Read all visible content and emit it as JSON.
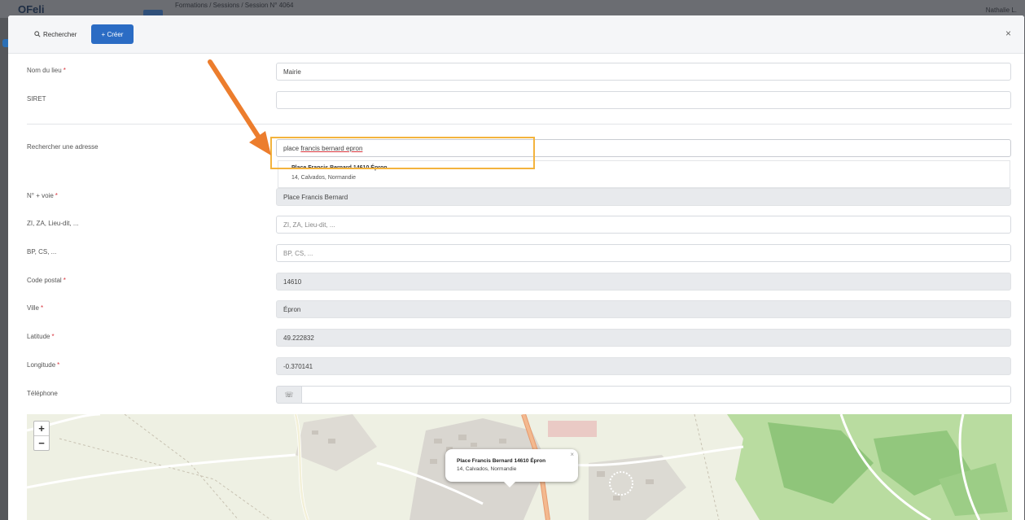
{
  "background": {
    "logo": "OFeli",
    "breadcrumb": "Formations / Sessions / Session N° 4064",
    "user": "Nathalie L."
  },
  "toolbar": {
    "search_label": "Rechercher",
    "create_label": "+ Créer",
    "close": "×"
  },
  "form": {
    "name": {
      "label": "Nom du lieu",
      "value": "Mairie"
    },
    "siret": {
      "label": "SIRET",
      "value": ""
    },
    "address_search": {
      "label": "Rechercher une adresse",
      "value_pre": "place ",
      "value_underlined": "francis bernard epron"
    },
    "suggestion": {
      "line1": "Place Francis Bernard 14610 Épron",
      "line2": "14, Calvados, Normandie"
    },
    "street": {
      "label": "N° + voie",
      "value": "Place Francis Bernard"
    },
    "zone": {
      "label": "ZI, ZA, Lieu-dit, ...",
      "placeholder": "ZI, ZA, Lieu-dit, ..."
    },
    "bp": {
      "label": "BP, CS, ...",
      "placeholder": "BP, CS, ..."
    },
    "postal": {
      "label": "Code postal",
      "value": "14610"
    },
    "city": {
      "label": "Ville",
      "value": "Épron"
    },
    "lat": {
      "label": "Latitude",
      "value": "49.222832"
    },
    "lon": {
      "label": "Longitude",
      "value": "-0.370141"
    },
    "phone": {
      "label": "Téléphone",
      "icon": "phone-icon",
      "glyph": "☏"
    },
    "required_mark": "*"
  },
  "map": {
    "zoom_in": "+",
    "zoom_out": "−",
    "popup": {
      "line1": "Place Francis Bernard 14610 Épron",
      "line2": "14, Calvados, Normandie",
      "close": "×"
    }
  },
  "colors": {
    "accent": "#2b6cc4",
    "highlight": "#f3b33d",
    "arrow": "#ec7d2d",
    "required": "#d9363e"
  }
}
